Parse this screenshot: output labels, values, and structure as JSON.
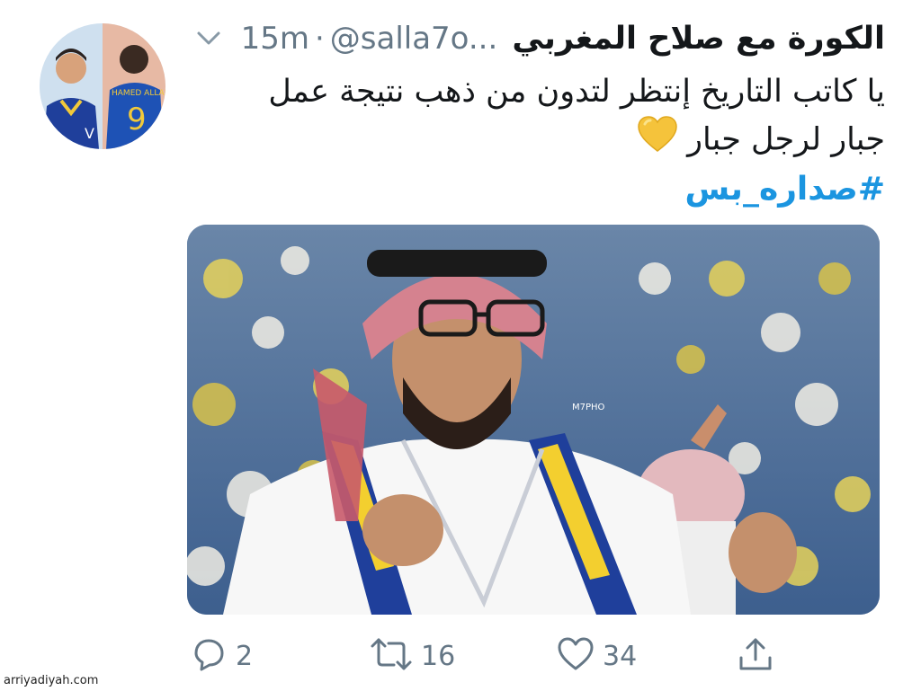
{
  "tweet": {
    "display_name": "الكورة مع صلاح المغربي",
    "handle": "@salla7o...",
    "separator": "·",
    "time": "15m",
    "text_line1": "يا كاتب التاريخ إنتظر لتدون من ذهب نتيجة عمل",
    "text_line2": "جبار لرجل جبار",
    "hashtag": "#صداره_بس",
    "avatar_jersey_text": "HAMED ALLAH",
    "avatar_jersey_number": "9",
    "image_watermark": "M7PHO"
  },
  "actions": {
    "reply_count": "2",
    "retweet_count": "16",
    "like_count": "34"
  },
  "icons": {
    "reply": "reply-icon",
    "retweet": "retweet-icon",
    "like": "like-icon",
    "share": "share-icon",
    "more": "chevron-down-icon",
    "emoji": "yellow-heart-emoji"
  },
  "colors": {
    "text": "#14171a",
    "muted": "#657786",
    "link": "#1b95e0",
    "heart": "#f5c33b"
  },
  "site_watermark": "arriyadiyah.com"
}
